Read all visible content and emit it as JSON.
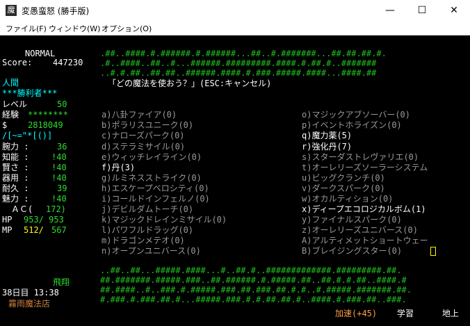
{
  "window": {
    "icon_glyph": "魔",
    "title": "変愚蛮怒 (勝手版)",
    "minimize": "—",
    "maximize": "☐",
    "close": "✕"
  },
  "menu": [
    "ファイル(F)",
    "ウィンドウ(W)",
    "オプション(O)"
  ],
  "sidebar": {
    "difficulty": "NORMAL",
    "score_label": "Score:",
    "score_value": "447230",
    "race": "人間",
    "title": "***勝利者***",
    "level_label": "レベル",
    "level_value": "50",
    "exp_label": "経験",
    "exp_value": "********",
    "gold_label": "$",
    "gold_value": "2818049",
    "equip_glyphs": "/[~=\"*[()]",
    "stats": [
      {
        "label": "腕力 :",
        "value": "36"
      },
      {
        "label": "知能 :",
        "value": "!40"
      },
      {
        "label": "賢さ :",
        "value": "!40"
      },
      {
        "label": "器用 :",
        "value": "!40"
      },
      {
        "label": "耐久 :",
        "value": "39"
      },
      {
        "label": "魅力 :",
        "value": "!40"
      }
    ],
    "ac_label": "ＡＣ(",
    "ac_value": "172)",
    "hp_label": "HP",
    "hp_value": "953/ 953",
    "mp_label": "MP",
    "mp_cur": "512/",
    "mp_max": "567",
    "status_fly": "飛翔",
    "date_time": "38日目 13:38",
    "location": "霧雨魔法店"
  },
  "prompt": "「どの魔法を使おう？」(ESC:キャンセル)",
  "spells_left": [
    {
      "text": "a)八卦ファイア(0)",
      "avail": false
    },
    {
      "text": "b)ポラリスユニーク(0)",
      "avail": false
    },
    {
      "text": "c)ナローズパーク(0)",
      "avail": false
    },
    {
      "text": "d)ステラミサイル(0)",
      "avail": false
    },
    {
      "text": "e)ウィッチレイライン(0)",
      "avail": false
    },
    {
      "text": "f)丹(3)",
      "avail": true
    },
    {
      "text": "g)ルミネスストライク(0)",
      "avail": false
    },
    {
      "text": "h)エスケープベロシティ(0)",
      "avail": false
    },
    {
      "text": "i)コールドインフェルノ(0)",
      "avail": false
    },
    {
      "text": "j)デビルダムトーチ(0)",
      "avail": false
    },
    {
      "text": "k)マジックドレインミサイル(0)",
      "avail": false
    },
    {
      "text": "l)パワフルドラッグ(0)",
      "avail": false
    },
    {
      "text": "m)ドラゴンメテオ(0)",
      "avail": false
    },
    {
      "text": "n)オープンユニバース(0)",
      "avail": false
    }
  ],
  "spells_right": [
    {
      "text": "o)マジックアブソーバー(0)",
      "avail": false
    },
    {
      "text": "p)イベントホライズン(0)",
      "avail": false
    },
    {
      "text": "q)魔力薬(5)",
      "avail": true
    },
    {
      "text": "r)強化丹(7)",
      "avail": true
    },
    {
      "text": "s)スターダストレヴァリエ(0)",
      "avail": false
    },
    {
      "text": "t)オーレリーズソーラーシステム",
      "avail": false
    },
    {
      "text": "u)ビッグクランチ(0)",
      "avail": false
    },
    {
      "text": "v)ダークスパーク(0)",
      "avail": false
    },
    {
      "text": "w)オカルティション(0)",
      "avail": false
    },
    {
      "text": "x)ディープエコロジカルボム(1)",
      "avail": true
    },
    {
      "text": "y)ファイナルスパーク(0)",
      "avail": false
    },
    {
      "text": "z)オーレリーズユニバース(0)",
      "avail": false
    },
    {
      "text": "A)アルティメットショートウェー",
      "avail": false
    },
    {
      "text": "B)ブレイジングスター(0)",
      "avail": false
    }
  ],
  "map_top": [
    ".##..####.#.######.#.######...##..#.#######...##.##.##.#.",
    ".#..####..##..#...######.#########.####.#.##.#..#######",
    "..#.#.##..##.##..######.####.#.###.#####.####...####.##"
  ],
  "map_bottom": [
    "..##..##...#####.####...#..##.#..#############.#########.##.",
    "##.#######.#####.###..##.######.#.#####.##..##.#.#.##..####.#",
    "##.####..#..###.#.#####.###.##.###.##.#.#..#.#####.#######.##.",
    "#.###.#.###.##.#...#####.###.#.#.##.##.#..####.#.###.##..###."
  ],
  "status_bar": {
    "speed": "加速(+45)",
    "study": "学習",
    "depth": "地上"
  }
}
